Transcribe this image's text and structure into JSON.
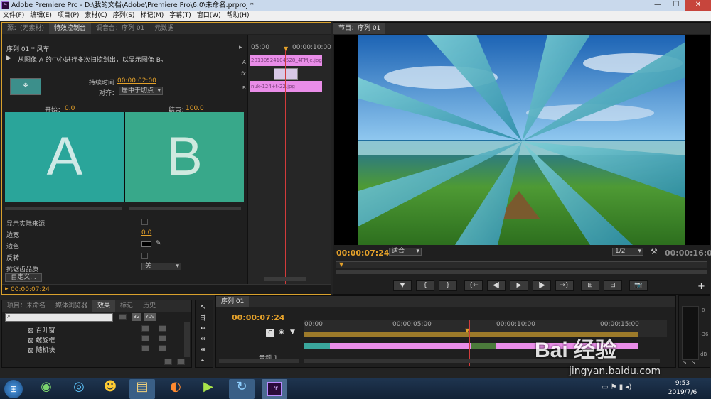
{
  "titlebar": {
    "title": "Adobe Premiere Pro - D:\\我的文档\\Adobe\\Premiere Pro\\6.0\\未命名.prproj *",
    "app_icon": "Pr",
    "min": "—",
    "max": "☐",
    "close": "✕"
  },
  "menu": [
    "文件(F)",
    "编辑(E)",
    "项目(P)",
    "素材(C)",
    "序列(S)",
    "标记(M)",
    "字幕(T)",
    "窗口(W)",
    "帮助(H)"
  ],
  "source_panel": {
    "tabs": [
      "源：(无素材)",
      "特效控制台",
      "调音台：序列 01",
      "元数据"
    ],
    "active_tab": "特效控制台",
    "seq_label": "序列 01 * 风车",
    "description": "从图像 A 的中心进行多次扫掠划出，以显示图像 B。",
    "duration_label": "持续时间",
    "duration_value": "00:00:02:00",
    "align_label": "对齐：",
    "align_value": "居中于切点",
    "start_label": "开始：",
    "start_value": "0.0",
    "end_label": "结束：",
    "end_value": "100.0",
    "letter_a": "A",
    "letter_b": "B",
    "props": [
      {
        "label": "显示实际来源",
        "value": ""
      },
      {
        "label": "边宽",
        "value": "0.0"
      },
      {
        "label": "边色",
        "value": ""
      },
      {
        "label": "反转",
        "value": ""
      },
      {
        "label": "抗锯齿品质",
        "value": "关"
      }
    ],
    "custom_button": "自定义...",
    "timecode": "00:00:07:24",
    "mini_tl": {
      "t0": "05:00",
      "t1": "00:00:10:00",
      "trackA": "A",
      "trackB": "B",
      "fx": "fx",
      "clipA": "20130524104528_4FMJe.jpg",
      "clipB": "nuk-124+t-22.jpg"
    }
  },
  "program_panel": {
    "tab": "节目：序列 01",
    "timecode": "00:00:07:24",
    "fit": "适合",
    "resolution": "1/2",
    "duration": "00:00:16:00",
    "buttons": [
      "▼",
      "{",
      "}",
      "{←",
      "◀|",
      "▶",
      "|▶",
      "→}",
      "⊞",
      "⊟",
      "📷"
    ],
    "plus": "+"
  },
  "project_panel": {
    "tabs": [
      "项目：未命名",
      "媒体浏览器",
      "效果",
      "标记",
      "历史"
    ],
    "active_tab": "效果",
    "search_placeholder": "",
    "badges": [
      "32",
      "YUV"
    ],
    "items": [
      "百叶窗",
      "螺旋框",
      "随机块"
    ]
  },
  "timeline_panel": {
    "tab": "序列 01",
    "timecode": "00:00:07:24",
    "ruler": [
      "00:00",
      "00:00:05:00",
      "00:00:10:00",
      "00:00:15:00"
    ],
    "audio_track": "音频 1"
  },
  "audio_meter": {
    "labels": [
      "0",
      "-36",
      "dB"
    ],
    "solo": "S",
    "solo2": "S"
  },
  "taskbar": {
    "time": "9:53",
    "date": "2019/7/6"
  },
  "watermark": {
    "brand": "Bai 经验",
    "url": "jingyan.baidu.com"
  },
  "colors": {
    "accent": "#e4a12a",
    "clip_pink": "#e98de8",
    "clip_teal": "#3aa69c",
    "playhead": "#d23b3b"
  }
}
